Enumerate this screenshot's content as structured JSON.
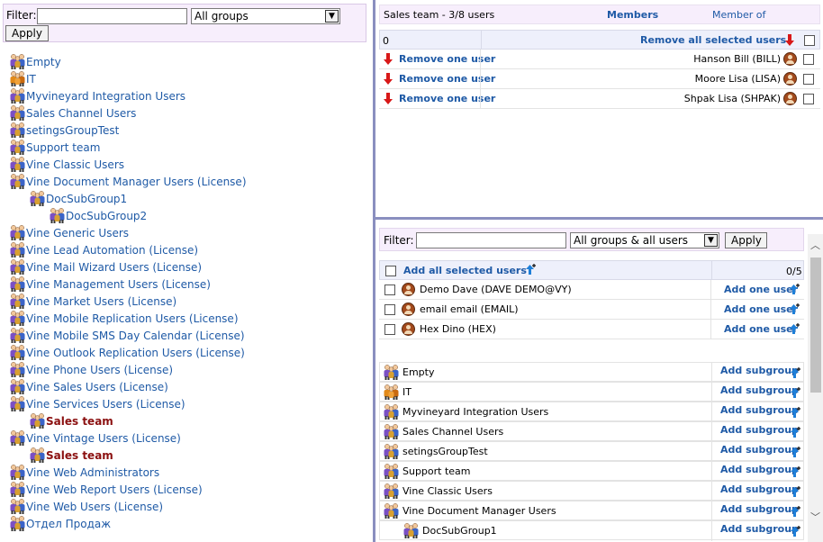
{
  "left_panel": {
    "filter_label": "Filter:",
    "filter_value": "",
    "group_select": "All groups",
    "apply_label": "Apply",
    "tree": [
      {
        "label": "Empty",
        "level": 0,
        "icon": "group-icon"
      },
      {
        "label": "IT",
        "level": 0,
        "icon": "group-icon-orange"
      },
      {
        "label": "Myvineyard Integration Users",
        "level": 0,
        "icon": "group-icon"
      },
      {
        "label": "Sales Channel Users",
        "level": 0,
        "icon": "group-icon"
      },
      {
        "label": "setingsGroupTest",
        "level": 0,
        "icon": "group-icon"
      },
      {
        "label": "Support team",
        "level": 0,
        "icon": "group-icon"
      },
      {
        "label": "Vine Classic Users",
        "level": 0,
        "icon": "group-icon"
      },
      {
        "label": "Vine Document Manager Users (License)",
        "level": 0,
        "icon": "group-icon"
      },
      {
        "label": "DocSubGroup1",
        "level": 1,
        "icon": "group-icon"
      },
      {
        "label": "DocSubGroup2",
        "level": 2,
        "icon": "group-icon"
      },
      {
        "label": "Vine Generic Users",
        "level": 0,
        "icon": "group-icon"
      },
      {
        "label": "Vine Lead Automation (License)",
        "level": 0,
        "icon": "group-icon"
      },
      {
        "label": "Vine Mail Wizard Users (License)",
        "level": 0,
        "icon": "group-icon"
      },
      {
        "label": "Vine Management Users (License)",
        "level": 0,
        "icon": "group-icon"
      },
      {
        "label": "Vine Market Users (License)",
        "level": 0,
        "icon": "group-icon"
      },
      {
        "label": "Vine Mobile Replication Users (License)",
        "level": 0,
        "icon": "group-icon"
      },
      {
        "label": "Vine Mobile SMS Day Calendar (License)",
        "level": 0,
        "icon": "group-icon"
      },
      {
        "label": "Vine Outlook Replication Users (License)",
        "level": 0,
        "icon": "group-icon"
      },
      {
        "label": "Vine Phone Users (License)",
        "level": 0,
        "icon": "group-icon"
      },
      {
        "label": "Vine Sales Users (License)",
        "level": 0,
        "icon": "group-icon"
      },
      {
        "label": "Vine Services Users (License)",
        "level": 0,
        "icon": "group-icon"
      },
      {
        "label": "Sales team",
        "level": 1,
        "icon": "group-icon",
        "selected": true
      },
      {
        "label": "Vine Vintage Users (License)",
        "level": 0,
        "icon": "group-icon"
      },
      {
        "label": "Sales team",
        "level": 1,
        "icon": "group-icon",
        "selected": true
      },
      {
        "label": "Vine Web Administrators",
        "level": 0,
        "icon": "group-icon"
      },
      {
        "label": "Vine Web Report Users (License)",
        "level": 0,
        "icon": "group-icon"
      },
      {
        "label": "Vine Web Users (License)",
        "level": 0,
        "icon": "group-icon"
      },
      {
        "label": "Отдел Продаж",
        "level": 0,
        "icon": "group-icon"
      }
    ]
  },
  "members_panel": {
    "title": "Sales team - 3/8 users",
    "tab_members": "Members",
    "tab_member_of": "Member of",
    "selected_count": "0",
    "remove_all_label": "Remove all selected users",
    "remove_one_label": "Remove one user",
    "members": [
      {
        "name": "Hanson Bill (BILL)"
      },
      {
        "name": "Moore Lisa (LISA)"
      },
      {
        "name": "Shpak Lisa (SHPAK)"
      }
    ]
  },
  "add_panel": {
    "filter_label": "Filter:",
    "filter_value": "",
    "group_select": "All groups & all users",
    "apply_label": "Apply",
    "add_all_label": "Add all selected users",
    "count": "0/5",
    "add_one_label": "Add one user",
    "users": [
      {
        "name": "Demo Dave (DAVE DEMO@VY)"
      },
      {
        "name": "email email (EMAIL)"
      },
      {
        "name": "Hex Dino (HEX)"
      }
    ],
    "add_subgroup_label": "Add subgroup",
    "groups": [
      {
        "label": "Empty",
        "level": 0,
        "icon": "group-icon"
      },
      {
        "label": "IT",
        "level": 0,
        "icon": "group-icon-orange"
      },
      {
        "label": "Myvineyard Integration Users",
        "level": 0,
        "icon": "group-icon"
      },
      {
        "label": "Sales Channel Users",
        "level": 0,
        "icon": "group-icon"
      },
      {
        "label": "setingsGroupTest",
        "level": 0,
        "icon": "group-icon"
      },
      {
        "label": "Support team",
        "level": 0,
        "icon": "group-icon"
      },
      {
        "label": "Vine Classic Users",
        "level": 0,
        "icon": "group-icon"
      },
      {
        "label": "Vine Document Manager Users",
        "level": 0,
        "icon": "group-icon"
      },
      {
        "label": "DocSubGroup1",
        "level": 1,
        "icon": "group-icon"
      }
    ]
  },
  "colors": {
    "link": "#1f5aa6",
    "selected": "#8b1010",
    "divider": "#8a8fbf",
    "filter_bg": "#f7eefc"
  }
}
